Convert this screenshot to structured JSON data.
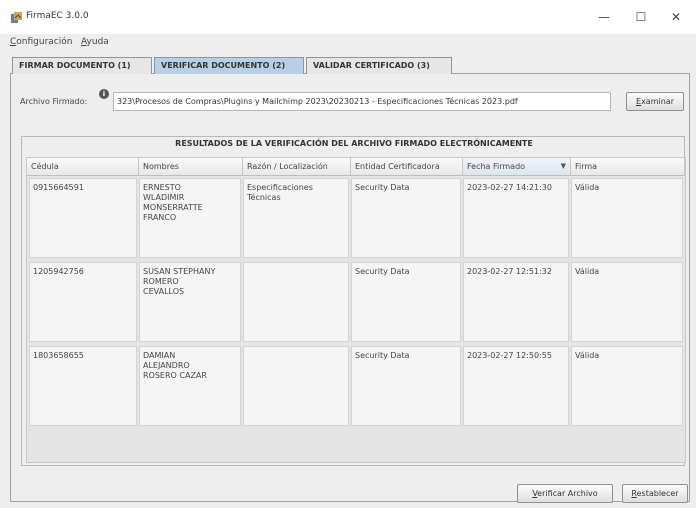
{
  "window": {
    "title": "FirmaEC 3.0.0",
    "controls": {
      "minimize": "—",
      "maximize": "☐",
      "close": "✕"
    }
  },
  "menu": {
    "items": [
      {
        "mnemonic": "C",
        "rest": "onfiguración"
      },
      {
        "mnemonic": "A",
        "rest": "yuda"
      }
    ]
  },
  "tabs": [
    {
      "label": "FIRMAR DOCUMENTO (1)",
      "active": false
    },
    {
      "label": "VERIFICAR DOCUMENTO (2)",
      "active": true
    },
    {
      "label": "VALIDAR CERTIFICADO (3)",
      "active": false
    }
  ],
  "file_row": {
    "label": "Archivo Firmado:",
    "info_icon": "i",
    "path": "323\\Procesos de Compras\\Plugins y Mailchimp 2023\\20230213 - Especificaciones Técnicas 2023.pdf",
    "browse_button": {
      "mnemonic": "E",
      "rest": "xaminar"
    }
  },
  "results": {
    "title": "RESULTADOS DE LA VERIFICACIÓN DEL ARCHIVO FIRMADO ELECTRÓNICAMENTE",
    "columns": [
      "Cédula",
      "Nombres",
      "Razón / Localización",
      "Entidad Certificadora",
      "Fecha Firmado",
      "Firma"
    ],
    "sort_indicator": "▼",
    "rows": [
      [
        "0915664591",
        "ERNESTO\nWLADIMIR\nMONSERRATTE\nFRANCO",
        "Especificaciones\nTécnicas",
        "Security Data",
        "2023-02-27 14:21:30",
        "Válida"
      ],
      [
        "1205942756",
        "SUSAN STEPHANY\nROMERO\nCEVALLOS",
        "",
        "Security Data",
        "2023-02-27 12:51:32",
        "Válida"
      ],
      [
        "1803658655",
        "DAMIAN\nALEJANDRO\nROSERO CAZAR",
        "",
        "Security Data",
        "2023-02-27 12:50:55",
        "Válida"
      ]
    ]
  },
  "footer": {
    "verify_button": {
      "mnemonic": "V",
      "rest": "erificar Archivo"
    },
    "reset_button": {
      "mnemonic": "R",
      "rest": "establecer"
    }
  }
}
